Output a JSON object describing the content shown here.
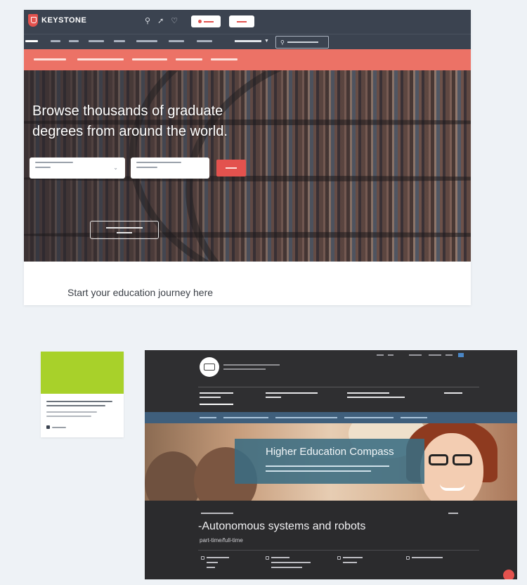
{
  "keystone": {
    "logo_text": "KEYSTONE",
    "hero_title": "Browse thousands of graduate degrees from around the world.",
    "journey_heading": "Start your education journey here",
    "colors": {
      "header": "#3b4350",
      "subnav": "#ec7266",
      "accent": "#e3524e"
    },
    "icons": [
      "search-icon",
      "rocket-icon",
      "heart-icon"
    ]
  },
  "card": {
    "image_color": "#a8d12a"
  },
  "compass": {
    "hero_title": "Higher Education Compass",
    "program_title": "-Autonomous systems and robots",
    "program_subtitle": "part-time/full-time",
    "colors": {
      "background": "#2f2f31",
      "breadcrumb": "#3f5f7c",
      "banner": "#3a6c82"
    }
  }
}
